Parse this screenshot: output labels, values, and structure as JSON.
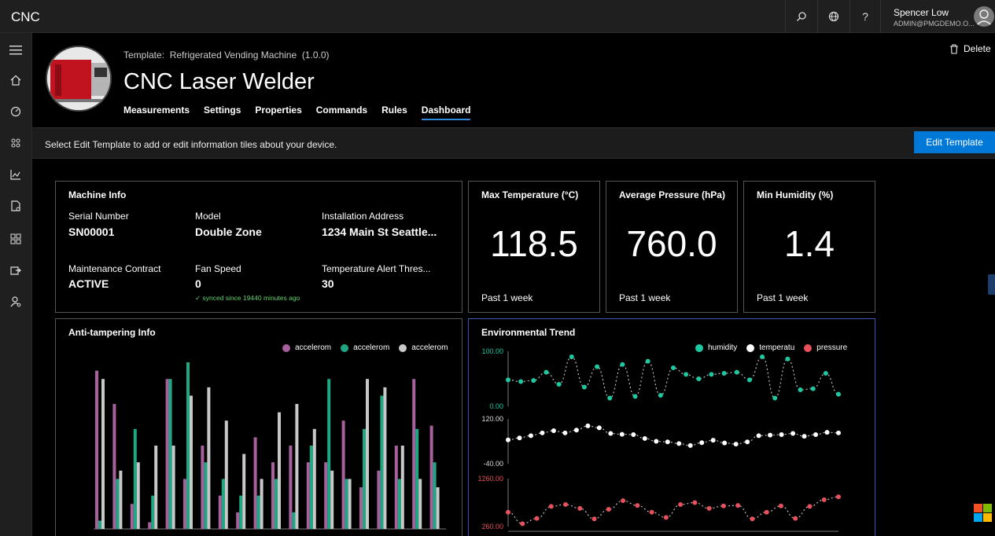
{
  "app": {
    "title": "CNC"
  },
  "topbar": {
    "search_icon": "search-icon",
    "globe_icon": "globe-icon",
    "help_label": "?",
    "user_name": "Spencer Low",
    "user_email": "ADMIN@PMGDEMO.O..."
  },
  "device": {
    "template_label": "Template:",
    "template_name": "Refrigerated Vending Machine",
    "template_version": "(1.0.0)",
    "name": "CNC Laser Welder",
    "delete_label": "Delete"
  },
  "tabs": [
    {
      "label": "Measurements",
      "active": false
    },
    {
      "label": "Settings",
      "active": false
    },
    {
      "label": "Properties",
      "active": false
    },
    {
      "label": "Commands",
      "active": false
    },
    {
      "label": "Rules",
      "active": false
    },
    {
      "label": "Dashboard",
      "active": true
    }
  ],
  "infobar": {
    "text": "Select Edit Template to add or edit information tiles about your device.",
    "button_label": "Edit Template"
  },
  "machine_info": {
    "title": "Machine Info",
    "fields": [
      {
        "label": "Serial Number",
        "value": "SN00001"
      },
      {
        "label": "Model",
        "value": "Double Zone"
      },
      {
        "label": "Installation Address",
        "value": "1234 Main St Seattle..."
      },
      {
        "label": "Maintenance Contract",
        "value": "ACTIVE"
      },
      {
        "label": "Fan Speed",
        "value": "0"
      },
      {
        "label": "Temperature Alert Thres...",
        "value": "30"
      }
    ],
    "synced_text": "synced since 19440 minutes ago"
  },
  "kpis": [
    {
      "title": "Max Temperature (°C)",
      "value": "118.5",
      "footer": "Past 1 week"
    },
    {
      "title": "Average Pressure (hPa)",
      "value": "760.0",
      "footer": "Past 1 week"
    },
    {
      "title": "Min Humidity (%)",
      "value": "1.4",
      "footer": "Past 1 week"
    }
  ],
  "colors": {
    "purple": "#a7609c",
    "green": "#1da782",
    "gray": "#c8c8c8",
    "teal": "#1ec9a2",
    "white": "#ffffff",
    "red": "#e8505b",
    "accent": "#0078d7"
  },
  "anti_tampering": {
    "title": "Anti-tampering Info",
    "legend": [
      "accelerom",
      "accelerom",
      "accelerom"
    ],
    "chart_data": {
      "type": "bar",
      "series": [
        {
          "name": "accelerom",
          "color": "#a7609c",
          "values": [
            0.95,
            0.75,
            0.15,
            0.04,
            0.9,
            0.3,
            0.5,
            0.2,
            0.1,
            0.55,
            0.4,
            0.5,
            0.4,
            0.4,
            0.65,
            0.25,
            0.35,
            0.5,
            0.9,
            0.62
          ]
        },
        {
          "name": "accelerom",
          "color": "#1da782",
          "values": [
            0.05,
            0.3,
            0.6,
            0.2,
            0.9,
            1.0,
            0.4,
            0.3,
            0.2,
            0.2,
            0.3,
            0.1,
            0.5,
            0.9,
            0.3,
            0.6,
            0.8,
            0.3,
            0.6,
            0.4
          ]
        },
        {
          "name": "accelerom",
          "color": "#c8c8c8",
          "values": [
            0.9,
            0.35,
            0.4,
            0.5,
            0.5,
            0.8,
            0.85,
            0.65,
            0.45,
            0.3,
            0.7,
            0.75,
            0.6,
            0.35,
            0.3,
            0.9,
            0.85,
            0.5,
            0.3,
            0.25
          ]
        }
      ]
    }
  },
  "environmental": {
    "title": "Environmental Trend",
    "legend": [
      "humidity",
      "temperatu",
      "pressure"
    ],
    "chart_data": {
      "type": "line",
      "series": [
        {
          "name": "humidity",
          "color": "#1ec9a2",
          "ylim": [
            0,
            100
          ],
          "ticks": [
            "100.00",
            "0.00"
          ],
          "values": [
            48,
            45,
            47,
            62,
            40,
            90,
            35,
            72,
            15,
            76,
            18,
            82,
            20,
            70,
            58,
            50,
            58,
            60,
            62,
            48,
            90,
            15,
            86,
            30,
            32,
            60,
            22
          ]
        },
        {
          "name": "temperatu",
          "color": "#ffffff",
          "ylim": [
            -40,
            120
          ],
          "ticks": [
            "120.00",
            "-40.00"
          ],
          "values": [
            45,
            52,
            60,
            70,
            78,
            70,
            80,
            95,
            88,
            68,
            65,
            64,
            50,
            40,
            38,
            32,
            25,
            35,
            44,
            34,
            30,
            38,
            60,
            62,
            64,
            68,
            58,
            64,
            72,
            70
          ]
        },
        {
          "name": "pressure",
          "color": "#e8505b",
          "ylim": [
            260,
            1260
          ],
          "ticks": [
            "1260.00",
            "260.00"
          ],
          "values": [
            560,
            320,
            430,
            680,
            720,
            640,
            420,
            620,
            800,
            700,
            560,
            450,
            720,
            760,
            640,
            690,
            700,
            420,
            560,
            690,
            430,
            680,
            820,
            880
          ]
        }
      ]
    }
  }
}
